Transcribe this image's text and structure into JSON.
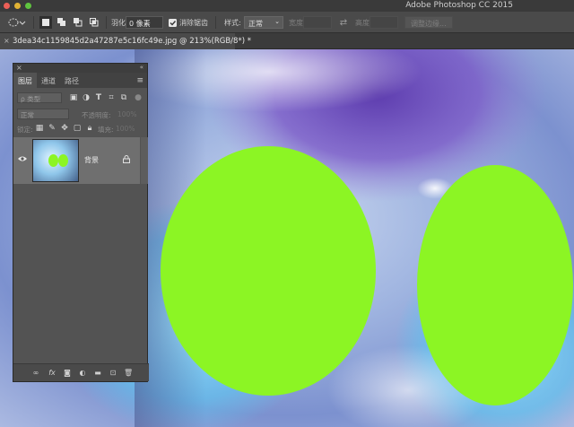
{
  "titlebar": {
    "app_title": "Adobe Photoshop CC 2015"
  },
  "options": {
    "feather_label": "羽化:",
    "feather_value": "0 像素",
    "antialias_label": "消除锯齿",
    "style_label": "样式:",
    "style_value": "正常",
    "width_label": "宽度:",
    "height_label": "高度:",
    "refine_edge_label": "调整边缘..."
  },
  "document": {
    "tab_title": "3dea34c1159845d2a47287e5c16fc49e.jpg @ 213%(RGB/8*) *",
    "close_glyph": "×"
  },
  "layers_panel": {
    "tabs": [
      "图层",
      "通道",
      "路径"
    ],
    "filter_kind": "ρ 类型",
    "blend_mode": "正常",
    "opacity_label": "不透明度:",
    "opacity_value": "100%",
    "lock_label": "锁定:",
    "fill_label": "填充:",
    "fill_value": "100%",
    "layer_name": "背景"
  },
  "colors": {
    "accent_green": "#8cf524",
    "panel_bg": "#535353",
    "optbar_bg": "#4a4a4a"
  }
}
